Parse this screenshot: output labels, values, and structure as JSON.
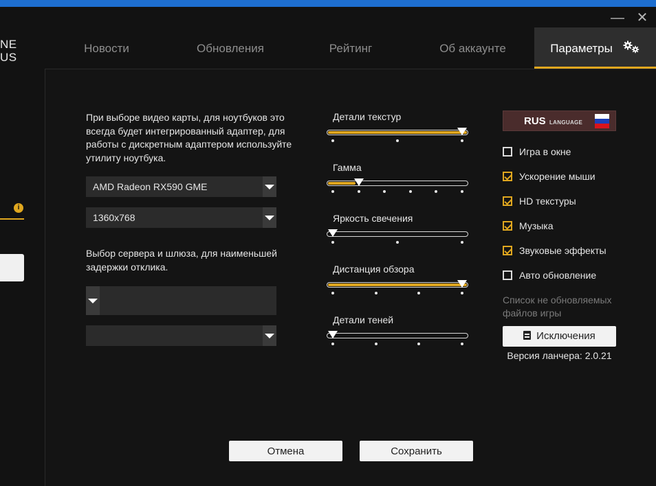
{
  "window": {
    "minimize_icon": "—",
    "close_icon": "✕"
  },
  "logo": {
    "line1": "NE",
    "line2": "US"
  },
  "tabs": [
    {
      "label": "Новости"
    },
    {
      "label": "Обновления"
    },
    {
      "label": "Рейтинг"
    },
    {
      "label": "Об аккаунте"
    },
    {
      "label": "Параметры",
      "active": true,
      "icon": "gear-icon"
    }
  ],
  "left_stub": {
    "info_icon": "i"
  },
  "video": {
    "description": "При выборе видео карты, для ноутбуков это всегда будет интегрированный адаптер, для работы с дискретным адаптером используйте утилиту ноутбука.",
    "gpu_select": "AMD Radeon RX590 GME",
    "resolution_select": "1360x768"
  },
  "server": {
    "description": "Выбор сервера и шлюза, для наименьшей задержки отклика.",
    "server_select": "",
    "gateway_select": ""
  },
  "sliders": [
    {
      "label": "Детали текстур",
      "value_fraction": 1.0,
      "steps": 3
    },
    {
      "label": "Гамма",
      "value_fraction": 0.2,
      "steps": 6
    },
    {
      "label": "Яркость свечения",
      "value_fraction": 0.0,
      "steps": 3
    },
    {
      "label": "Дистанция обзора",
      "value_fraction": 1.0,
      "steps": 4
    },
    {
      "label": "Детали теней",
      "value_fraction": 0.0,
      "steps": 4
    }
  ],
  "language": {
    "code": "RUS",
    "word": "LANGUAGE",
    "flag_colors": [
      "#ffffff",
      "#1c3fb8",
      "#d8141c"
    ]
  },
  "options": [
    {
      "label": "Игра в окне",
      "checked": false
    },
    {
      "label": "Ускорение мыши",
      "checked": true
    },
    {
      "label": "HD текстуры",
      "checked": true
    },
    {
      "label": "Музыка",
      "checked": true
    },
    {
      "label": "Звуковые эффекты",
      "checked": true
    },
    {
      "label": "Авто обновление",
      "checked": false
    }
  ],
  "exclusions": {
    "note": "Список не обновляемых файлов игры",
    "button_label": "Исключения",
    "version": "Версия ланчера: 2.0.21"
  },
  "footer": {
    "cancel_label": "Отмена",
    "save_label": "Сохранить"
  },
  "colors": {
    "accent": "#e0a71f",
    "titlebar": "#1e6fd0",
    "background": "#121212"
  }
}
